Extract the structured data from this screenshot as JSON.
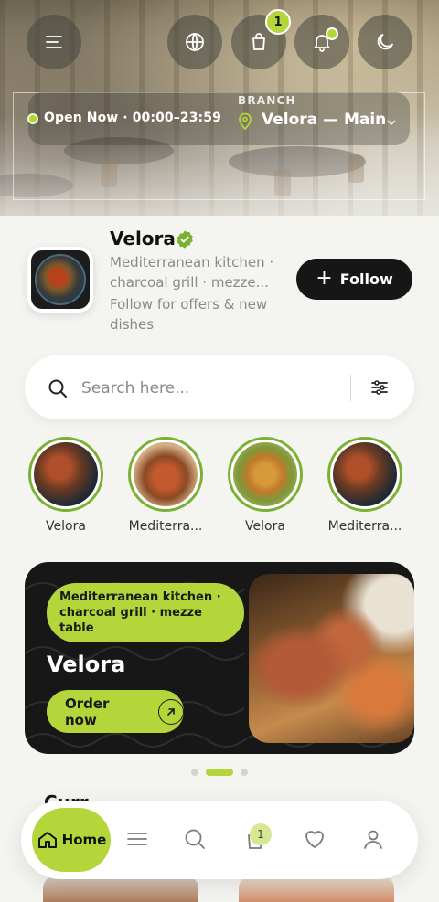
{
  "header": {
    "icons": [
      "menu-icon",
      "globe-icon",
      "bag-icon",
      "bell-icon",
      "moon-icon"
    ],
    "cart_count": "1",
    "status_text": "Open Now · 00:00–23:59",
    "branch_caption": "BRANCH",
    "branch_name": "Velora — Main"
  },
  "profile": {
    "name": "Velora",
    "description": "Mediterranean kitchen · charcoal grill · mezze...",
    "subtext": "Follow for offers & new dishes",
    "follow_label": "Follow"
  },
  "search": {
    "placeholder": "Search here..."
  },
  "stories": [
    {
      "label": "Velora"
    },
    {
      "label": "Mediterra..."
    },
    {
      "label": "Velora"
    },
    {
      "label": "Mediterra..."
    }
  ],
  "promo": {
    "tag": "Mediterranean kitchen · charcoal grill · mezze table",
    "title": "Velora",
    "cta": "Order now",
    "slide_count": 3,
    "active_slide": 2
  },
  "section": {
    "peek_title": "Curr"
  },
  "bottom_nav": {
    "home_label": "Home",
    "cart_count": "1",
    "items": [
      "home-icon",
      "menu-icon",
      "search-icon",
      "bag-icon",
      "heart-icon",
      "user-icon"
    ]
  },
  "colors": {
    "accent": "#b5d63a",
    "dark": "#161616",
    "background": "#f4f4f1"
  }
}
